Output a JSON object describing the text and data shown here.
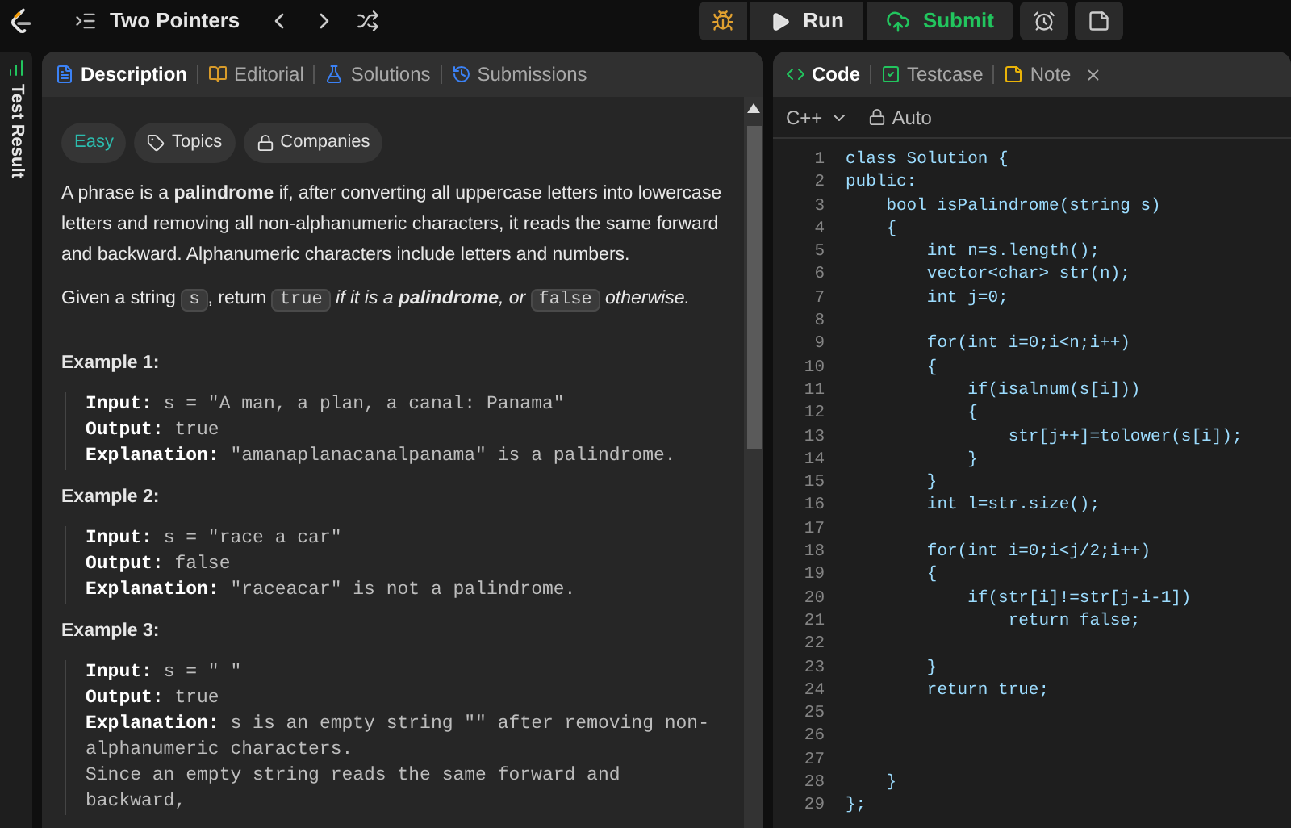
{
  "topbar": {
    "problem_list": "Two Pointers",
    "run": "Run",
    "submit": "Submit"
  },
  "side_tab": "Test Result",
  "left_tabs": [
    {
      "label": "Description",
      "selected": true
    },
    {
      "label": "Editorial",
      "selected": false
    },
    {
      "label": "Solutions",
      "selected": false
    },
    {
      "label": "Submissions",
      "selected": false
    }
  ],
  "tags": [
    {
      "kind": "difficulty",
      "label": "Easy"
    },
    {
      "kind": "topics",
      "label": "Topics"
    },
    {
      "kind": "companies",
      "label": "Companies"
    }
  ],
  "paragraphs": [
    [
      {
        "kind": "text",
        "text": "A phrase is a **palindrome** if, after converting all uppercase letters into lowercase letters and removing all non-alphanumeric characters, it reads the same forward and backward. Alphanumeric characters include letters and numbers."
      }
    ],
    [
      {
        "kind": "text",
        "text": "Given a string "
      },
      {
        "kind": "code",
        "text": "s"
      },
      {
        "kind": "text",
        "text": ", return "
      },
      {
        "kind": "code",
        "text": "true"
      },
      {
        "kind": "italic",
        "text": " if it is a **palindrome**, or "
      },
      {
        "kind": "code",
        "text": "false"
      },
      {
        "kind": "italic",
        "text": " otherwise."
      }
    ]
  ],
  "examples": [
    {
      "title": "Example 1:",
      "lines": [
        {
          "label": "Input:",
          "value": "s = \"A man, a plan, a canal: Panama\""
        },
        {
          "label": "Output:",
          "value": "true"
        },
        {
          "label": "Explanation:",
          "value": "\"amanaplanacanalpanama\" is a palindrome."
        }
      ]
    },
    {
      "title": "Example 2:",
      "lines": [
        {
          "label": "Input:",
          "value": "s = \"race a car\""
        },
        {
          "label": "Output:",
          "value": "false"
        },
        {
          "label": "Explanation:",
          "value": "\"raceacar\" is not a palindrome."
        }
      ]
    },
    {
      "title": "Example 3:",
      "lines": [
        {
          "label": "Input:",
          "value": "s = \" \""
        },
        {
          "label": "Output:",
          "value": "true"
        },
        {
          "label": "Explanation:",
          "value": "s is an empty string \"\" after removing non-alphanumeric characters."
        },
        {
          "value": "Since an empty string reads the same forward and backward,"
        }
      ]
    }
  ],
  "right_tabs": [
    {
      "label": "Code",
      "selected": true,
      "closable": false
    },
    {
      "label": "Testcase",
      "selected": false,
      "closable": false
    },
    {
      "label": "Note",
      "selected": false,
      "closable": true
    }
  ],
  "language": "C++",
  "mode": "Auto",
  "code_lines": [
    {
      "number": "1",
      "text": "class Solution {"
    },
    {
      "number": "2",
      "text": "public:"
    },
    {
      "number": "3",
      "text": "    bool isPalindrome(string s)"
    },
    {
      "number": "4",
      "text": "    {"
    },
    {
      "number": "5",
      "text": "        int n=s.length();"
    },
    {
      "number": "6",
      "text": "        vector<char> str(n);"
    },
    {
      "number": "7",
      "text": "        int j=0;"
    },
    {
      "number": "8"
    },
    {
      "number": "9",
      "text": "        for(int i=0;i<n;i++)"
    },
    {
      "number": "10",
      "text": "        {"
    },
    {
      "number": "11",
      "text": "            if(isalnum(s[i]))"
    },
    {
      "number": "12",
      "text": "            {"
    },
    {
      "number": "13",
      "text": "                str[j++]=tolower(s[i]);"
    },
    {
      "number": "14",
      "text": "            }"
    },
    {
      "number": "15",
      "text": "        }"
    },
    {
      "number": "16",
      "text": "        int l=str.size();"
    },
    {
      "number": "17"
    },
    {
      "number": "18",
      "text": "        for(int i=0;i<j/2;i++)"
    },
    {
      "number": "19",
      "text": "        {"
    },
    {
      "number": "20",
      "text": "            if(str[i]!=str[j-i-1])"
    },
    {
      "number": "21",
      "text": "                return false;"
    },
    {
      "number": "22"
    },
    {
      "number": "23",
      "text": "        }"
    },
    {
      "number": "24",
      "text": "        return true;"
    },
    {
      "number": "25"
    },
    {
      "number": "26"
    },
    {
      "number": "27"
    },
    {
      "number": "28",
      "text": "    }"
    },
    {
      "number": "29",
      "text": "};"
    }
  ]
}
